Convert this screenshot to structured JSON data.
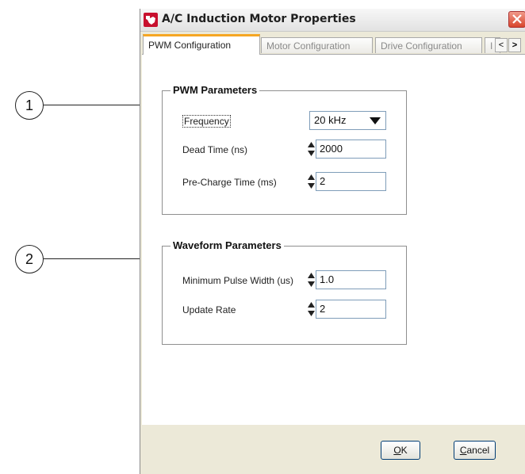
{
  "callouts": [
    "1",
    "2"
  ],
  "window": {
    "title": "A/C Induction Motor Properties"
  },
  "tabs": [
    {
      "label": "PWM Configuration",
      "active": true
    },
    {
      "label": "Motor Configuration",
      "active": false
    },
    {
      "label": "Drive Configuration",
      "active": false
    },
    {
      "label": "I",
      "active": false
    }
  ],
  "tab_scroll": {
    "left": "<",
    "right": ">"
  },
  "pwm_group": {
    "title": "PWM Parameters",
    "frequency_label": "Frequency",
    "frequency_value": "20 kHz",
    "dead_time_label": "Dead Time (ns)",
    "dead_time_value": "2000",
    "precharge_label": "Pre-Charge Time (ms)",
    "precharge_value": "2"
  },
  "waveform_group": {
    "title": "Waveform Parameters",
    "min_pulse_label": "Minimum Pulse Width (us)",
    "min_pulse_value": "1.0",
    "update_rate_label": "Update Rate",
    "update_rate_value": "2"
  },
  "buttons": {
    "ok_mnemonic": "O",
    "ok_rest": "K",
    "cancel_mnemonic": "C",
    "cancel_rest": "ancel"
  },
  "colors": {
    "active_tab_accent": "#f5a623",
    "close_button": "#d8452c"
  }
}
